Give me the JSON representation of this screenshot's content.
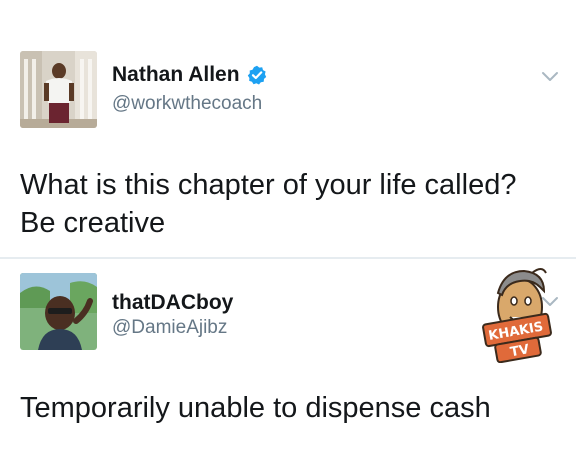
{
  "tweets": [
    {
      "display_name": "Nathan Allen",
      "handle": "@workwthecoach",
      "verified": true,
      "text_lines": [
        "What is this chapter of your life called?",
        "Be creative"
      ]
    },
    {
      "display_name": "thatDACboy",
      "handle": "@DamieAjibz",
      "verified": false,
      "text_lines": [
        "Temporarily unable to dispense cash"
      ]
    }
  ],
  "watermark": {
    "text": "KHAKIS TV"
  },
  "colors": {
    "verified_blue": "#1da1f2",
    "handle_gray": "#657786",
    "text_dark": "#14171a",
    "divider": "#e6ecf0",
    "caret_gray": "#aab8c2"
  },
  "icons": {
    "verified": "verified-badge-icon",
    "caret": "chevron-down-icon"
  }
}
